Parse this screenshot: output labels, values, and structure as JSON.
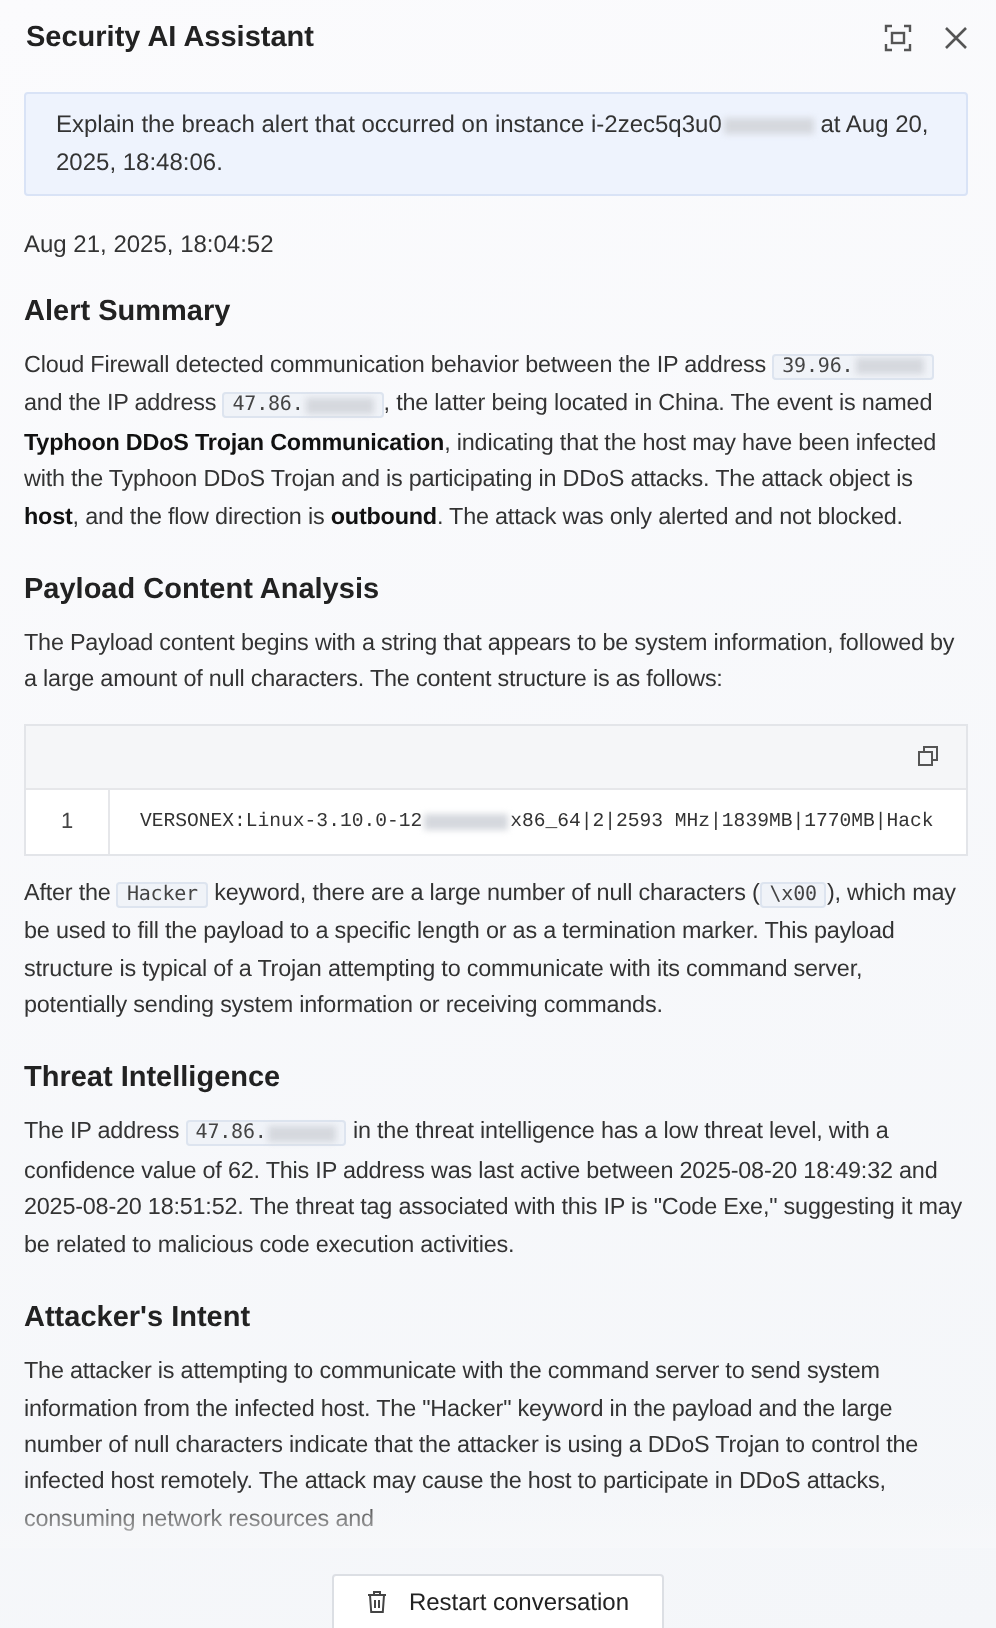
{
  "window": {
    "title": "Security AI Assistant"
  },
  "question": [
    {
      "kind": "text",
      "text": "Explain the breach alert that occurred on instance i-2zec5q3u0"
    },
    {
      "kind": "redacted"
    },
    {
      "kind": "text",
      "text": " at Aug 20, 2025, 18:48:06."
    }
  ],
  "timestamp": "Aug 21, 2025, 18:04:52",
  "sections": [
    {
      "heading": "Alert Summary",
      "blocks": [
        {
          "kind": "paragraph",
          "segments": [
            {
              "kind": "text",
              "text": "Cloud Firewall detected communication behavior between the IP address "
            },
            {
              "kind": "code",
              "text": "39.96.",
              "redacted": true
            },
            {
              "kind": "text",
              "text": " and the IP address "
            },
            {
              "kind": "code",
              "text": "47.86.",
              "redacted": true
            },
            {
              "kind": "text",
              "text": ", the latter being located in China. The event is named **Typhoon DDoS Trojan Communication**, indicating that the host may have been infected with the Typhoon DDoS Trojan and is participating in DDoS attacks. The attack object is **host**, and the flow direction is **outbound**. The attack was only alerted and not blocked."
            }
          ]
        }
      ]
    },
    {
      "heading": "Payload Content Analysis",
      "blocks": [
        {
          "kind": "paragraph",
          "segments": [
            {
              "kind": "text",
              "text": "The Payload content begins with a string that appears to be system information, followed by a large amount of null characters. The content structure is as follows:"
            }
          ]
        },
        {
          "kind": "codeblock",
          "lines": [
            {
              "number": "1",
              "segments": [
                {
                  "kind": "text",
                  "text": "VERSONEX:Linux-3.10.0-12"
                },
                {
                  "kind": "redacted"
                },
                {
                  "kind": "text",
                  "text": "x86_64|2|2593 MHz|1839MB|1770MB|Hack"
                }
              ]
            }
          ]
        },
        {
          "kind": "paragraph",
          "segments": [
            {
              "kind": "text",
              "text": "After the "
            },
            {
              "kind": "code",
              "text": "Hacker",
              "redacted": false
            },
            {
              "kind": "text",
              "text": " keyword, there are a large number of null characters ("
            },
            {
              "kind": "code",
              "text": "\\x00",
              "redacted": false
            },
            {
              "kind": "text",
              "text": "), which may be used to fill the payload to a specific length or as a termination marker. This payload structure is typical of a Trojan attempting to communicate with its command server, potentially sending system information or receiving commands."
            }
          ]
        }
      ]
    },
    {
      "heading": "Threat Intelligence",
      "blocks": [
        {
          "kind": "paragraph",
          "segments": [
            {
              "kind": "text",
              "text": "The IP address "
            },
            {
              "kind": "code",
              "text": "47.86.",
              "redacted": true
            },
            {
              "kind": "text",
              "text": " in the threat intelligence has a low threat level, with a confidence value of 62. This IP address was last active between 2025-08-20 18:49:32 and 2025-08-20 18:51:52. The threat tag associated with this IP is \"Code Exe,\" suggesting it may be related to malicious code execution activities."
            }
          ]
        }
      ]
    },
    {
      "heading": "Attacker's Intent",
      "blocks": [
        {
          "kind": "paragraph",
          "segments": [
            {
              "kind": "text",
              "text": "The attacker is attempting to communicate with the command server to send system information from the infected host. The \"Hacker\" keyword in the payload and the large number of null characters indicate that the attacker is using a DDoS Trojan to control the infected host remotely. The attack may cause the host to participate in DDoS attacks, consuming network resources and"
            }
          ]
        }
      ]
    }
  ],
  "restart_button": {
    "label": "Restart conversation"
  }
}
